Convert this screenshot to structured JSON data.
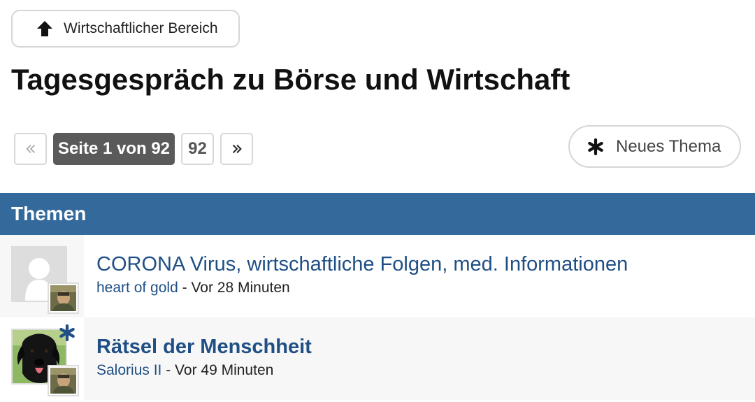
{
  "back_button": {
    "label": "Wirtschaftlicher Bereich",
    "icon": "arrow-up-icon"
  },
  "page_title": "Tagesgespräch zu Börse und Wirtschaft",
  "pagination": {
    "first_icon": "double-chevron-left-icon",
    "current_label": "Seite 1 von 92",
    "last_page": "92",
    "next_icon": "double-chevron-right-icon"
  },
  "new_topic_button": {
    "label": "Neues Thema",
    "icon": "asterisk-icon"
  },
  "section_header": "Themen",
  "topics": [
    {
      "title": "CORONA Virus, wirtschaftliche Folgen, med. Informationen",
      "author": "heart of gold",
      "separator": " - ",
      "time": "Vor 28 Minuten",
      "avatar": "default-avatar-icon",
      "last_poster_avatar": "user-avatar-thumbnail",
      "new_marker": false
    },
    {
      "title": "Rätsel der Menschheit",
      "author": "Salorius II",
      "separator": " - ",
      "time": "Vor 49 Minuten",
      "avatar": "dog-avatar-image",
      "last_poster_avatar": "user-avatar-thumbnail",
      "new_marker": true
    }
  ],
  "colors": {
    "accent": "#34699c",
    "link": "#1f4f85",
    "pager_current": "#5a5a5a"
  }
}
